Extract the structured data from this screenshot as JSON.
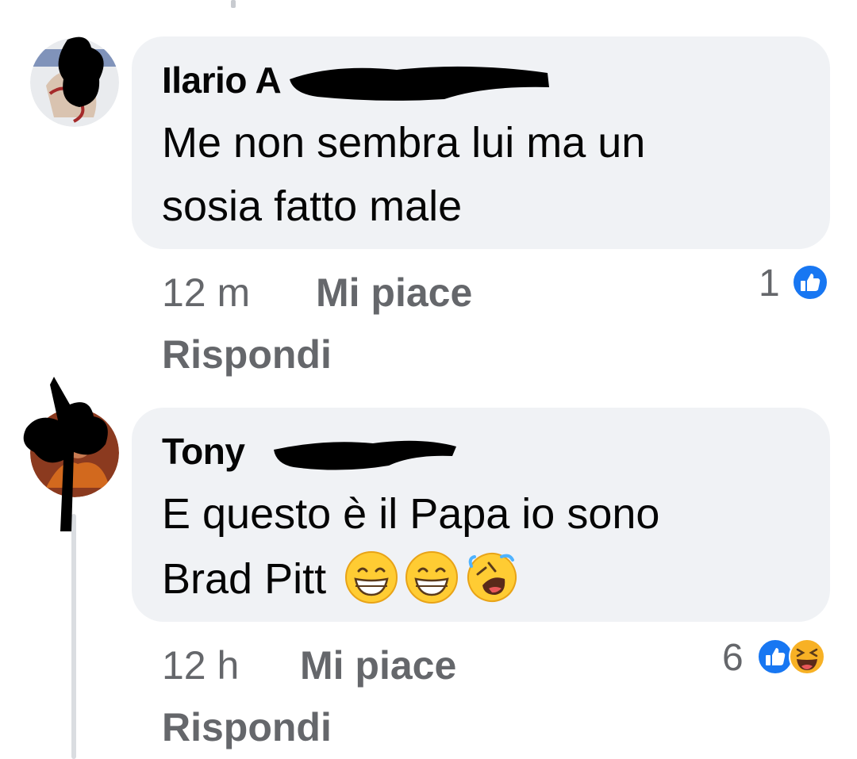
{
  "comments": [
    {
      "author": "Ilario A",
      "text_line1": "Me non sembra lui ma un",
      "text_line2": "sosia fatto male",
      "time": "12 m",
      "like_label": "Mi piace",
      "reply_label": "Rispondi",
      "reaction_count": "1",
      "reactions": [
        "like-icon"
      ]
    },
    {
      "author": "Tony",
      "text_line1": "E questo è il Papa io sono",
      "text_line2": "Brad Pitt",
      "emojis": [
        "grinning-face-icon",
        "grinning-face-icon",
        "rolling-laughing-icon"
      ],
      "time": "12 h",
      "like_label": "Mi piace",
      "reply_label": "Rispondi",
      "reaction_count": "6",
      "reactions": [
        "like-icon",
        "haha-icon"
      ]
    }
  ],
  "colors": {
    "bubble": "#f0f2f5",
    "meta_text": "#65676b",
    "like_blue": "#1877f2",
    "haha_yellow": "#f7b125"
  }
}
